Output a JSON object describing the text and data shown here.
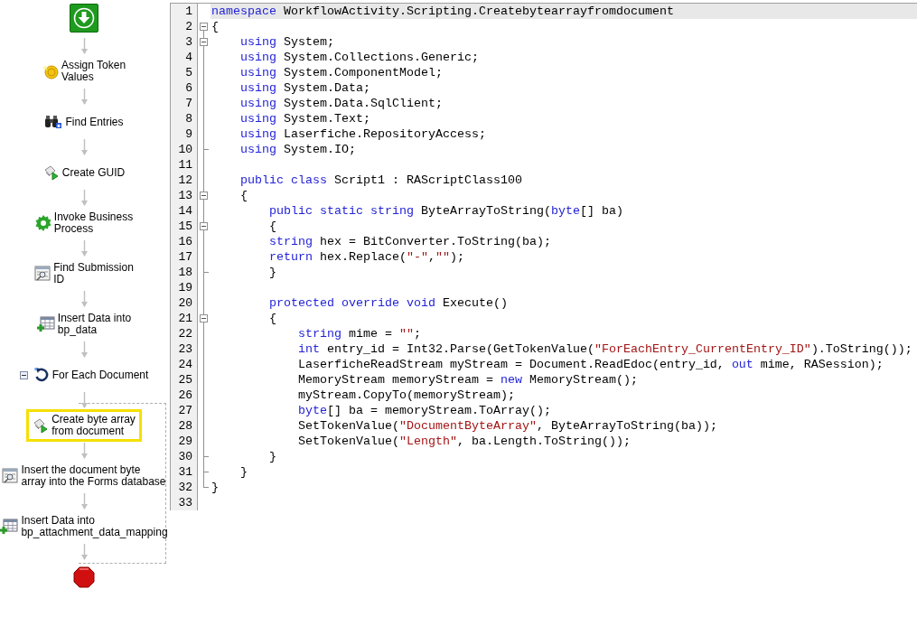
{
  "workflow": {
    "nodes": [
      {
        "kind": "start",
        "selected": false
      },
      {
        "kind": "token_activity",
        "label_lines": [
          "Assign Token",
          "Values"
        ],
        "selected": false
      },
      {
        "kind": "search_activity",
        "label_lines": [
          "Find Entries"
        ],
        "selected": false
      },
      {
        "kind": "script_activity",
        "label_lines": [
          "Create GUID"
        ],
        "selected": false
      },
      {
        "kind": "workflow_activity",
        "label_lines": [
          "Invoke Business",
          "Process"
        ],
        "selected": false
      },
      {
        "kind": "query_activity",
        "label_lines": [
          "Find Submission",
          "ID"
        ],
        "selected": false
      },
      {
        "kind": "insert_activity",
        "label_lines": [
          "Insert Data into",
          "bp_data"
        ],
        "selected": false
      },
      {
        "kind": "loop",
        "label_lines": [
          "For Each Document"
        ],
        "expanded": true,
        "selected": false,
        "children": [
          {
            "kind": "script_activity",
            "label_lines": [
              "Create byte array",
              "from document"
            ],
            "selected": true
          },
          {
            "kind": "query_activity",
            "label_lines": [
              "Insert the document byte",
              "array into the Forms database"
            ],
            "selected": false
          },
          {
            "kind": "insert_activity",
            "label_lines": [
              "Insert Data into",
              "bp_attachment_data_mapping"
            ],
            "selected": false
          }
        ]
      },
      {
        "kind": "end",
        "selected": false
      }
    ]
  },
  "editor": {
    "lines": [
      {
        "number": "1",
        "current": true,
        "tokens": [
          {
            "kind": "keyword",
            "text": "namespace"
          },
          {
            "kind": "plain",
            "text": " WorkflowActivity.Scripting.Createbytearrayfromdocument"
          }
        ]
      },
      {
        "number": "2",
        "expanded": true,
        "current": false,
        "tokens": [
          {
            "kind": "plain",
            "text": "{"
          }
        ]
      },
      {
        "number": "3",
        "expanded": true,
        "current": false,
        "tokens": [
          {
            "kind": "keyword",
            "text": "    using"
          },
          {
            "kind": "plain",
            "text": " System;"
          }
        ]
      },
      {
        "number": "4",
        "current": false,
        "tokens": [
          {
            "kind": "keyword",
            "text": "    using"
          },
          {
            "kind": "plain",
            "text": " System.Collections.Generic;"
          }
        ]
      },
      {
        "number": "5",
        "current": false,
        "tokens": [
          {
            "kind": "keyword",
            "text": "    using"
          },
          {
            "kind": "plain",
            "text": " System.ComponentModel;"
          }
        ]
      },
      {
        "number": "6",
        "current": false,
        "tokens": [
          {
            "kind": "keyword",
            "text": "    using"
          },
          {
            "kind": "plain",
            "text": " System.Data;"
          }
        ]
      },
      {
        "number": "7",
        "current": false,
        "tokens": [
          {
            "kind": "keyword",
            "text": "    using"
          },
          {
            "kind": "plain",
            "text": " System.Data.SqlClient;"
          }
        ]
      },
      {
        "number": "8",
        "current": false,
        "tokens": [
          {
            "kind": "keyword",
            "text": "    using"
          },
          {
            "kind": "plain",
            "text": " System.Text;"
          }
        ]
      },
      {
        "number": "9",
        "current": false,
        "tokens": [
          {
            "kind": "keyword",
            "text": "    using"
          },
          {
            "kind": "plain",
            "text": " Laserfiche.RepositoryAccess;"
          }
        ]
      },
      {
        "number": "10",
        "fold_end": true,
        "current": false,
        "tokens": [
          {
            "kind": "keyword",
            "text": "    using"
          },
          {
            "kind": "plain",
            "text": " System.IO;"
          }
        ]
      },
      {
        "number": "11",
        "current": false
      },
      {
        "number": "12",
        "current": false,
        "tokens": [
          {
            "kind": "keyword",
            "text": "    public class"
          },
          {
            "kind": "plain",
            "text": " Script1 : RAScriptClass100"
          }
        ]
      },
      {
        "number": "13",
        "expanded": true,
        "current": false,
        "tokens": [
          {
            "kind": "plain",
            "text": "    {"
          }
        ]
      },
      {
        "number": "14",
        "current": false,
        "tokens": [
          {
            "kind": "keyword",
            "text": "        public static string"
          },
          {
            "kind": "plain",
            "text": " ByteArrayToString("
          },
          {
            "kind": "keyword",
            "text": "byte"
          },
          {
            "kind": "plain",
            "text": "[] ba)"
          }
        ]
      },
      {
        "number": "15",
        "expanded": true,
        "current": false,
        "tokens": [
          {
            "kind": "plain",
            "text": "        {"
          }
        ]
      },
      {
        "number": "16",
        "current": false,
        "tokens": [
          {
            "kind": "keyword",
            "text": "        string"
          },
          {
            "kind": "plain",
            "text": " hex = BitConverter.ToString(ba);"
          }
        ]
      },
      {
        "number": "17",
        "current": false,
        "tokens": [
          {
            "kind": "keyword",
            "text": "        return"
          },
          {
            "kind": "plain",
            "text": " hex.Replace("
          },
          {
            "kind": "string",
            "text": "\"-\""
          },
          {
            "kind": "plain",
            "text": ","
          },
          {
            "kind": "string",
            "text": "\"\""
          },
          {
            "kind": "plain",
            "text": ");"
          }
        ]
      },
      {
        "number": "18",
        "fold_end": true,
        "current": false,
        "tokens": [
          {
            "kind": "plain",
            "text": "        }"
          }
        ]
      },
      {
        "number": "19",
        "current": false
      },
      {
        "number": "20",
        "current": false,
        "tokens": [
          {
            "kind": "keyword",
            "text": "        protected override void"
          },
          {
            "kind": "plain",
            "text": " Execute()"
          }
        ]
      },
      {
        "number": "21",
        "expanded": true,
        "current": false,
        "tokens": [
          {
            "kind": "plain",
            "text": "        {"
          }
        ]
      },
      {
        "number": "22",
        "current": false,
        "tokens": [
          {
            "kind": "keyword",
            "text": "            string"
          },
          {
            "kind": "plain",
            "text": " mime = "
          },
          {
            "kind": "string",
            "text": "\"\""
          },
          {
            "kind": "plain",
            "text": ";"
          }
        ]
      },
      {
        "number": "23",
        "current": false,
        "tokens": [
          {
            "kind": "keyword",
            "text": "            int"
          },
          {
            "kind": "plain",
            "text": " entry_id = Int32.Parse(GetTokenValue("
          },
          {
            "kind": "string",
            "text": "\"ForEachEntry_CurrentEntry_ID\""
          },
          {
            "kind": "plain",
            "text": ").ToString());"
          }
        ]
      },
      {
        "number": "24",
        "current": false,
        "tokens": [
          {
            "kind": "plain",
            "text": "            LaserficheReadStream myStream = Document.ReadEdoc(entry_id, "
          },
          {
            "kind": "keyword",
            "text": "out"
          },
          {
            "kind": "plain",
            "text": " mime, RASession);"
          }
        ]
      },
      {
        "number": "25",
        "current": false,
        "tokens": [
          {
            "kind": "plain",
            "text": "            MemoryStream memoryStream = "
          },
          {
            "kind": "keyword",
            "text": "new"
          },
          {
            "kind": "plain",
            "text": " MemoryStream();"
          }
        ]
      },
      {
        "number": "26",
        "current": false,
        "tokens": [
          {
            "kind": "plain",
            "text": "            myStream.CopyTo(memoryStream);"
          }
        ]
      },
      {
        "number": "27",
        "current": false,
        "tokens": [
          {
            "kind": "keyword",
            "text": "            byte"
          },
          {
            "kind": "plain",
            "text": "[] ba = memoryStream.ToArray();"
          }
        ]
      },
      {
        "number": "28",
        "current": false,
        "tokens": [
          {
            "kind": "plain",
            "text": "            SetTokenValue("
          },
          {
            "kind": "string",
            "text": "\"DocumentByteArray\""
          },
          {
            "kind": "plain",
            "text": ", ByteArrayToString(ba));"
          }
        ]
      },
      {
        "number": "29",
        "current": false,
        "tokens": [
          {
            "kind": "plain",
            "text": "            SetTokenValue("
          },
          {
            "kind": "string",
            "text": "\"Length\""
          },
          {
            "kind": "plain",
            "text": ", ba.Length.ToString());"
          }
        ]
      },
      {
        "number": "30",
        "fold_end": true,
        "current": false,
        "tokens": [
          {
            "kind": "plain",
            "text": "        }"
          }
        ]
      },
      {
        "number": "31",
        "fold_end": true,
        "current": false,
        "tokens": [
          {
            "kind": "plain",
            "text": "    }"
          }
        ]
      },
      {
        "number": "32",
        "fold_end": true,
        "current": false,
        "tokens": [
          {
            "kind": "plain",
            "text": "}"
          }
        ]
      },
      {
        "number": "33",
        "current": false
      }
    ]
  }
}
